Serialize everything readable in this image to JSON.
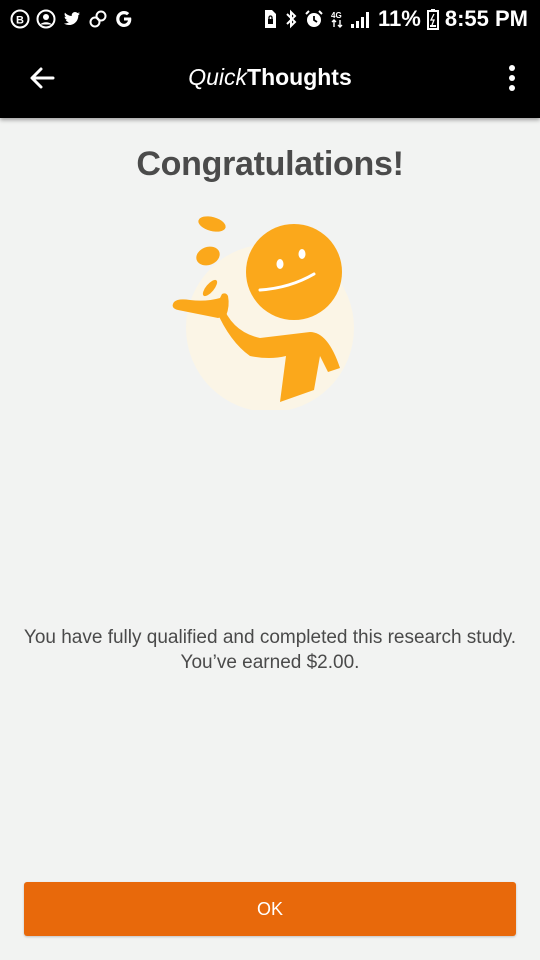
{
  "status_bar": {
    "left_icons": [
      "circle-b-icon",
      "account-circle-icon",
      "twitter-icon",
      "link-icon",
      "google-g-icon"
    ],
    "right_icons": [
      "sim-lock-icon",
      "bluetooth-icon",
      "alarm-icon",
      "data-signal-icon",
      "cell-signal-icon",
      "battery-icon"
    ],
    "battery_percent": "11%",
    "time": "8:55 PM"
  },
  "app_bar": {
    "title_part1": "Quick",
    "title_part2": "Thoughts",
    "back_icon": "arrow-back-icon",
    "menu_icon": "more-vert-icon"
  },
  "main": {
    "headline": "Congratulations!",
    "illustration": "smiling-figure-tossing-coins",
    "message": "You have fully qualified and completed this research study. You’ve earned $2.00."
  },
  "ok_button": {
    "label": "OK"
  },
  "colors": {
    "accent": "#e8690b",
    "figure": "#fba81b",
    "background": "#f2f3f2",
    "app_bar": "#000000"
  }
}
